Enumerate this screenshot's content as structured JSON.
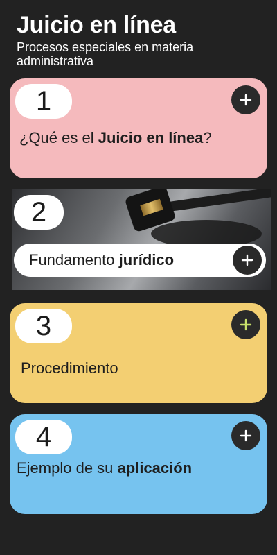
{
  "header": {
    "title": "Juicio en línea",
    "subtitle": "Procesos especiales en materia administrativa"
  },
  "cards": [
    {
      "number": "1",
      "text_prefix": "¿Qué es el ",
      "text_bold": "Juicio en línea",
      "text_suffix": "?",
      "color": "#f5babd",
      "button_icon": "plus-icon"
    },
    {
      "number": "2",
      "text_prefix": "Fundamento ",
      "text_bold": "jurídico",
      "text_suffix": "",
      "image": "gavel-photo",
      "button_icon": "plus-icon"
    },
    {
      "number": "3",
      "text_prefix": "Procedimiento",
      "text_bold": "",
      "text_suffix": "",
      "color": "#f3cf72",
      "button_icon": "plus-icon"
    },
    {
      "number": "4",
      "text_prefix": "Ejemplo de su ",
      "text_bold": "aplicación",
      "text_suffix": "",
      "color": "#76c3ef",
      "button_icon": "plus-icon"
    }
  ],
  "colors": {
    "background": "#222222",
    "button": "#2a2a2a",
    "plus_default": "#ffffff",
    "plus_card3": "#c8e06a"
  }
}
